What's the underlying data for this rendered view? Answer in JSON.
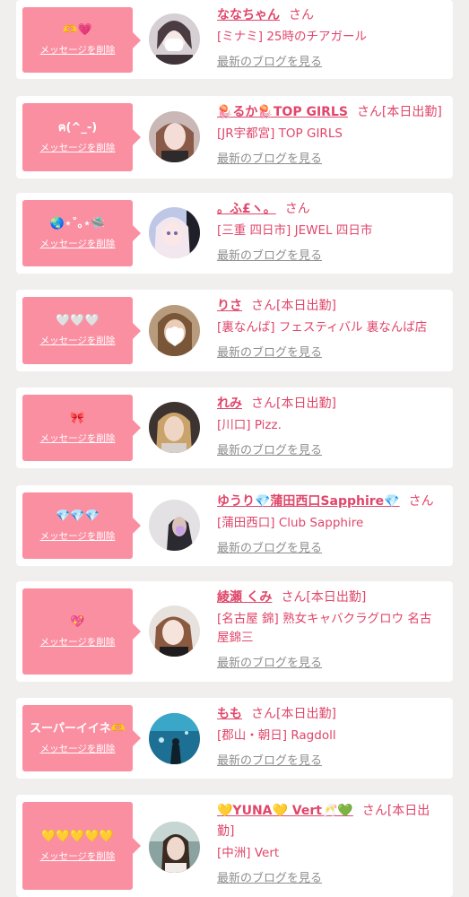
{
  "delete_label": "メッセージを削除",
  "blog_label": "最新のブログを見る",
  "accent": "#fb8fa2",
  "name_color": "#e0466a",
  "entries": [
    {
      "message": "🫶💗",
      "name": "ななちゃん",
      "suffix": "さん",
      "shop": "[ミナミ] 25時のチアガール",
      "avatar_icon": "avatar-photo"
    },
    {
      "message": "ฅ(^_-)",
      "name": "🪼るか🪼TOP GIRLS",
      "suffix": "さん[本日出勤]",
      "shop": "[JR宇都宮] TOP GIRLS",
      "avatar_icon": "avatar-photo"
    },
    {
      "message": "🌏⋆˚｡⋆🛸",
      "name": "。ふ£ヽ。",
      "suffix": "さん",
      "shop": "[三重 四日市] JEWEL 四日市",
      "avatar_icon": "avatar-photo"
    },
    {
      "message": "🤍🤍🤍",
      "name": "りさ",
      "suffix": "さん[本日出勤]",
      "shop": "[裏なんば] フェスティバル 裏なんば店",
      "avatar_icon": "avatar-photo"
    },
    {
      "message": "🎀",
      "name": "れみ",
      "suffix": "さん[本日出勤]",
      "shop": "[川口] Pizz.",
      "avatar_icon": "avatar-photo"
    },
    {
      "message": "💎💎💎",
      "name": "ゆうり💎蒲田西口Sapphire💎",
      "suffix": "さん",
      "shop": "[蒲田西口] Club Sapphire",
      "avatar_icon": "avatar-photo"
    },
    {
      "message": "💖",
      "name": "綾瀬 くみ",
      "suffix": "さん[本日出勤]",
      "shop": "[名古屋 錦] 熟女キャバクラグロウ 名古屋錦三",
      "avatar_icon": "avatar-photo"
    },
    {
      "message": "スーパーイイネ🫶",
      "name": "もも",
      "suffix": "さん[本日出勤]",
      "shop": "[郡山・朝日] Ragdoll",
      "avatar_icon": "avatar-photo"
    },
    {
      "message": "💛💛💛💛💛",
      "name": "💛YUNA💛 Vert🥂💚",
      "suffix": "さん[本日出勤]",
      "shop": "[中洲] Vert",
      "avatar_icon": "avatar-photo"
    }
  ]
}
